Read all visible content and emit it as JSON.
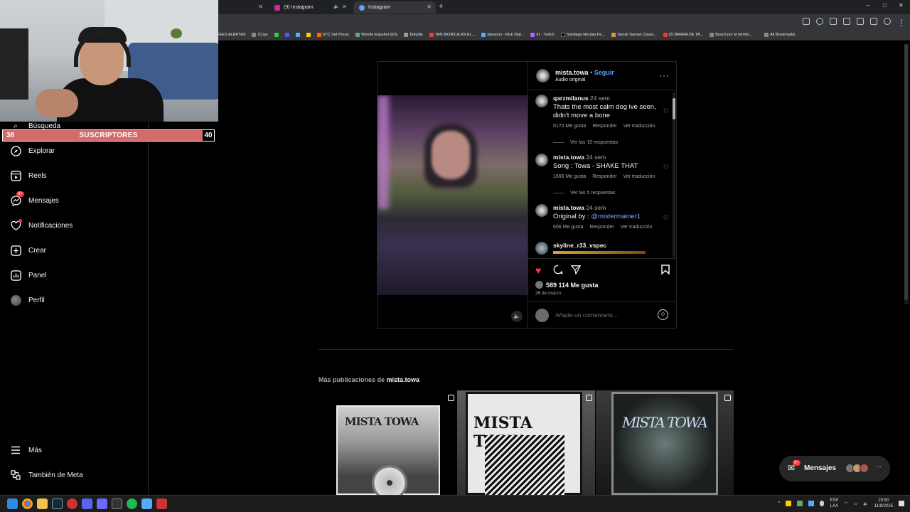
{
  "browser": {
    "tabs": [
      {
        "label": "(9) Instagram",
        "active": false
      },
      {
        "label": "Instagram",
        "active": true
      }
    ],
    "window_controls": [
      "–",
      "□",
      "✕"
    ],
    "bookmarks": [
      "FEED ALERTAS",
      "CLips",
      "STC Set Prices",
      "Wordle Español (ES)",
      "Boludle",
      "TAN BIONICA EN EL...",
      "sionaron - Kick Stat...",
      "trr - Twitch",
      "Santiago Nicolas Fe...",
      "Tanuki Sunset Classi...",
      "(2) BARRA DE TA...",
      "Buscó por el términ...",
      "All Bookmarks"
    ]
  },
  "overlay": {
    "subs_left": "38",
    "subs_label": "SUSCRIPTORES",
    "subs_right": "40"
  },
  "sidebar": {
    "search": "Búsqueda",
    "items": [
      {
        "label": "Explorar",
        "icon": "compass-icon"
      },
      {
        "label": "Reels",
        "icon": "reels-icon"
      },
      {
        "label": "Mensajes",
        "icon": "messenger-icon",
        "badge": "9+"
      },
      {
        "label": "Notificaciones",
        "icon": "heart-icon"
      },
      {
        "label": "Crear",
        "icon": "plus-square-icon"
      },
      {
        "label": "Panel",
        "icon": "chart-icon"
      },
      {
        "label": "Perfil",
        "icon": "avatar"
      }
    ],
    "more": "Más",
    "meta": "También de Meta"
  },
  "post": {
    "username": "mista.towa",
    "follow": "Seguir",
    "separator": "•",
    "audio": "Audio original",
    "comments": [
      {
        "user": "qarzmilanus",
        "time": "24 sem",
        "text": "Thats the most calm dog ive seen, didn't move a bone",
        "likes": "5170 Me gusta",
        "reply": "Responder",
        "translate": "Ver traducción",
        "replies": "Ver las 10 respuestas"
      },
      {
        "user": "mista.towa",
        "time": "24 sem",
        "text": "Song : Towa - SHAKE THAT",
        "likes": "1666 Me gusta",
        "reply": "Responder",
        "translate": "Ver traducción",
        "replies": "Ver las 5 respuestas"
      },
      {
        "user": "mista.towa",
        "time": "24 sem",
        "text_prefix": "Original by : ",
        "mention": "@mistermainer1",
        "likes": "606 Me gusta",
        "reply": "Responder",
        "translate": "Ver traducción"
      },
      {
        "user": "skyline_r33_vspec"
      }
    ],
    "like_count": "589 114 Me gusta",
    "date": "26 de marzo",
    "add_comment_placeholder": "Añade un comentario..."
  },
  "more_posts": {
    "prefix": "Más publicaciones de",
    "user": "mista.towa",
    "thumbs": [
      "MISTA TOWA",
      "MISTA TOWA",
      "MISTA TOWA"
    ]
  },
  "messages_float": {
    "badge": "9+",
    "label": "Mensajes",
    "dots": "···"
  },
  "tray": {
    "lang1": "ESP",
    "lang2": "LAA",
    "time": "20:50",
    "date": "11/9/2025"
  }
}
